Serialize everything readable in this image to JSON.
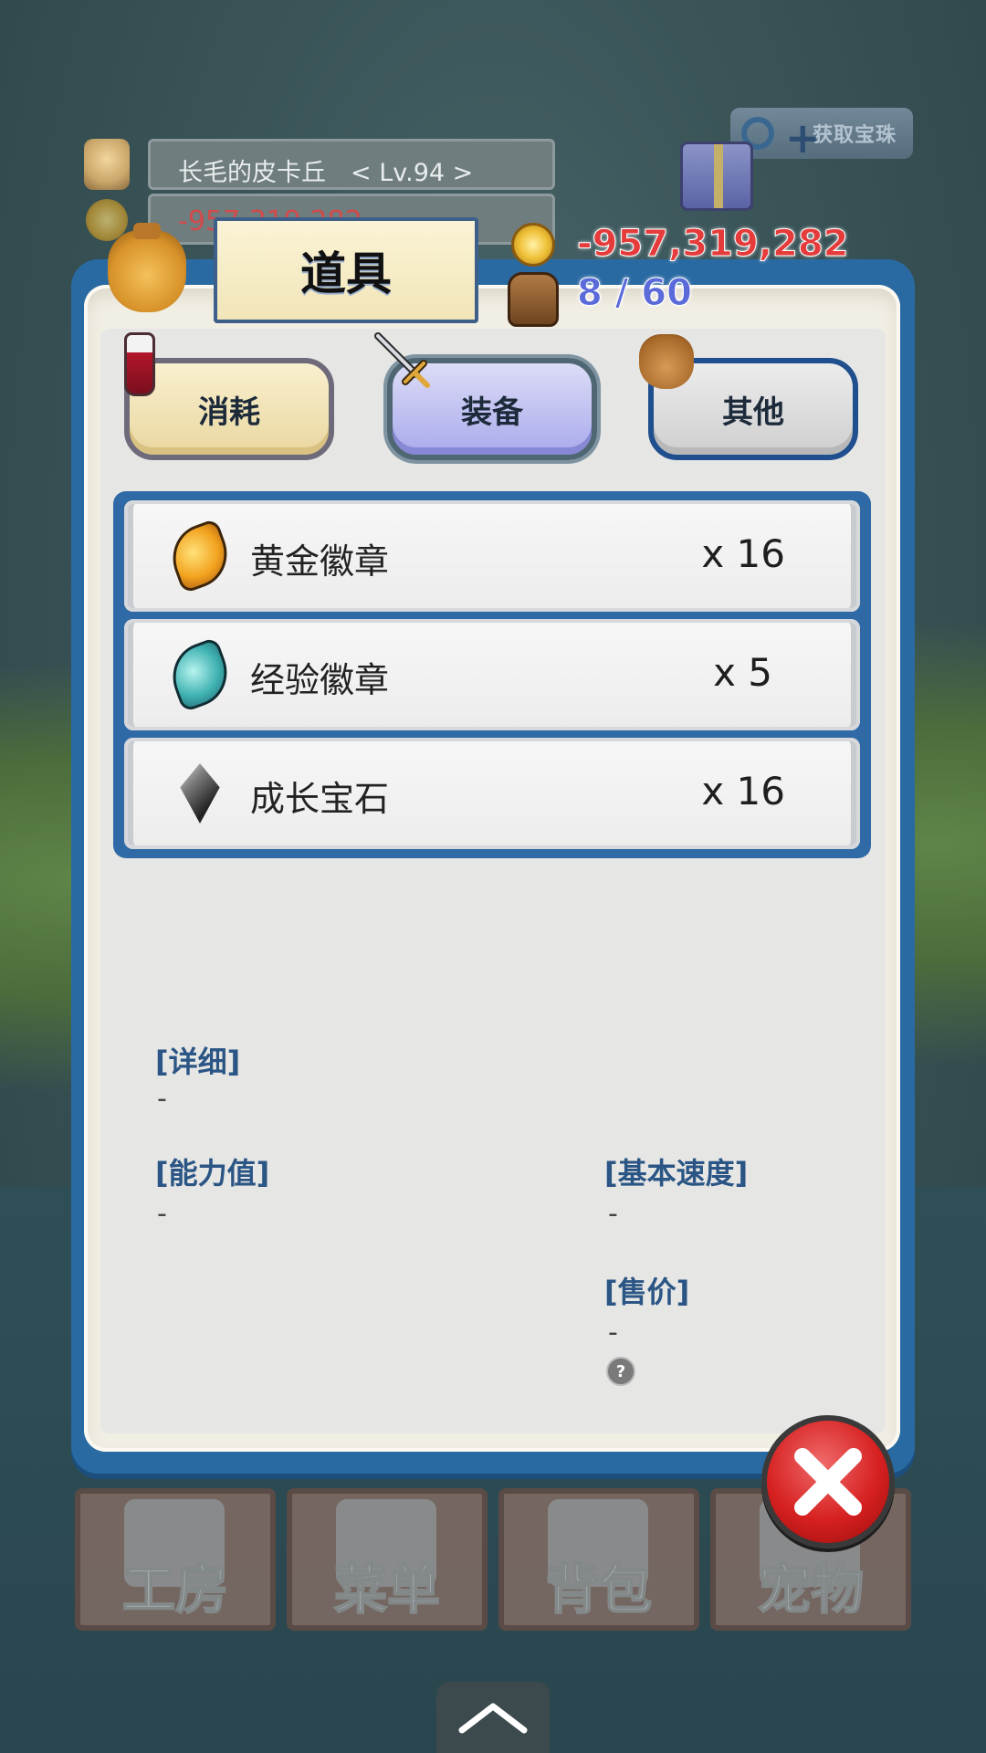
{
  "player": {
    "name_level": "长毛的皮卡丘　< Lv.94 >",
    "gold_bg": "-957,319,282"
  },
  "panel": {
    "title": "道具",
    "gold": "-957,319,282",
    "capacity": "8 / 60"
  },
  "tabs": [
    {
      "label": "消耗",
      "icon": "potion-icon"
    },
    {
      "label": "装备",
      "icon": "sword-icon",
      "selected": true
    },
    {
      "label": "其他",
      "icon": "pouch-icon"
    }
  ],
  "items": [
    {
      "name": "黄金徽章",
      "qty": "x 16",
      "icon": "gold-badge-icon"
    },
    {
      "name": "经验徽章",
      "qty": "x 5",
      "icon": "exp-badge-icon"
    },
    {
      "name": "成长宝石",
      "qty": "x 16",
      "icon": "gem-icon"
    }
  ],
  "details": {
    "detail_label": "[详细]",
    "detail_value": "-",
    "ability_label": "[能力值]",
    "ability_value": "-",
    "speed_label": "[基本速度]",
    "speed_value": "-",
    "price_label": "[售价]",
    "price_value": "-",
    "help": "?"
  },
  "nav": [
    {
      "label": "工房",
      "icon": "workshop-icon"
    },
    {
      "label": "菜单",
      "icon": "menu-book-icon"
    },
    {
      "label": "背包",
      "icon": "backpack-icon"
    },
    {
      "label": "宠物",
      "icon": "pet-icon"
    }
  ],
  "extra_button": "获取宝珠",
  "colors": {
    "panel_frame": "#2a6aa3",
    "gold_text": "#e63b3b",
    "capacity_text": "#5a6ad8",
    "label_blue": "#2a5585"
  }
}
